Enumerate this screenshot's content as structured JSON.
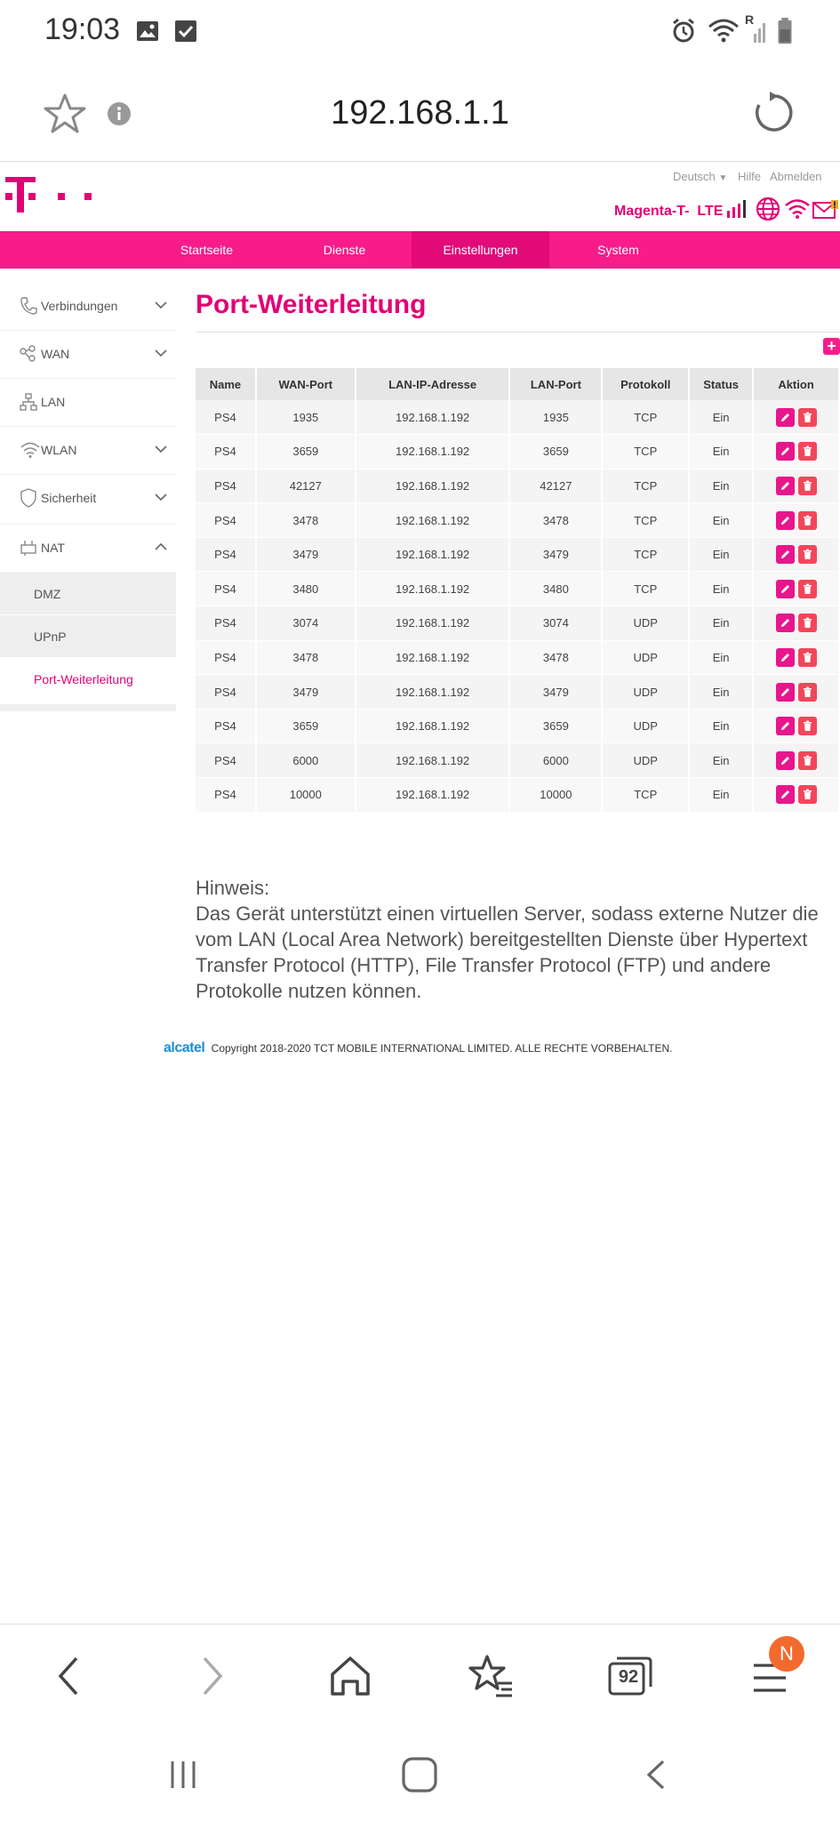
{
  "status_bar": {
    "time": "19:03",
    "icons": [
      "image-icon",
      "checkbox-icon",
      "alarm-icon",
      "wifi-icon",
      "signal-roaming-icon",
      "battery-icon"
    ],
    "roaming_label": "R"
  },
  "browser": {
    "url": "192.168.1.1",
    "icons": [
      "star-icon",
      "info-icon",
      "reload-icon"
    ]
  },
  "router": {
    "top_links": [
      "Deutsch",
      "Hilfe",
      "Abmelden"
    ],
    "operator": "Magenta-T-",
    "network_type": "LTE",
    "nav": [
      "Startseite",
      "Dienste",
      "Einstellungen",
      "System"
    ],
    "active_nav": "Einstellungen"
  },
  "sidebar": {
    "items": [
      {
        "label": "Verbindungen",
        "icon": "phone-icon",
        "expanded": false
      },
      {
        "label": "WAN",
        "icon": "wan-icon",
        "expanded": false
      },
      {
        "label": "LAN",
        "icon": "lan-icon",
        "expanded": null
      },
      {
        "label": "WLAN",
        "icon": "wifi-icon",
        "expanded": false
      },
      {
        "label": "Sicherheit",
        "icon": "shield-icon",
        "expanded": false
      },
      {
        "label": "NAT",
        "icon": "nat-icon",
        "expanded": true
      }
    ],
    "sub_items": [
      "DMZ",
      "UPnP",
      "Port-Weiterleitung"
    ],
    "active_sub": "Port-Weiterleitung"
  },
  "page": {
    "title": "Port-Weiterleitung",
    "add_label": "+"
  },
  "table": {
    "headers": [
      "Name",
      "WAN-Port",
      "LAN-IP-Adresse",
      "LAN-Port",
      "Protokoll",
      "Status",
      "Aktion"
    ],
    "rows": [
      [
        "PS4",
        "1935",
        "192.168.1.192",
        "1935",
        "TCP",
        "Ein"
      ],
      [
        "PS4",
        "3659",
        "192.168.1.192",
        "3659",
        "TCP",
        "Ein"
      ],
      [
        "PS4",
        "42127",
        "192.168.1.192",
        "42127",
        "TCP",
        "Ein"
      ],
      [
        "PS4",
        "3478",
        "192.168.1.192",
        "3478",
        "TCP",
        "Ein"
      ],
      [
        "PS4",
        "3479",
        "192.168.1.192",
        "3479",
        "TCP",
        "Ein"
      ],
      [
        "PS4",
        "3480",
        "192.168.1.192",
        "3480",
        "TCP",
        "Ein"
      ],
      [
        "PS4",
        "3074",
        "192.168.1.192",
        "3074",
        "UDP",
        "Ein"
      ],
      [
        "PS4",
        "3478",
        "192.168.1.192",
        "3478",
        "UDP",
        "Ein"
      ],
      [
        "PS4",
        "3479",
        "192.168.1.192",
        "3479",
        "UDP",
        "Ein"
      ],
      [
        "PS4",
        "3659",
        "192.168.1.192",
        "3659",
        "UDP",
        "Ein"
      ],
      [
        "PS4",
        "6000",
        "192.168.1.192",
        "6000",
        "UDP",
        "Ein"
      ],
      [
        "PS4",
        "10000",
        "192.168.1.192",
        "10000",
        "TCP",
        "Ein"
      ]
    ]
  },
  "hint": {
    "title": "Hinweis:",
    "text": "Das Gerät unterstützt einen virtuellen Server, sodass externe Nutzer die vom LAN (Local Area Network) bereitgestellten Dienste über Hypertext Transfer Protocol (HTTP), File Transfer Protocol (FTP) und andere Protokolle nutzen können."
  },
  "footer": {
    "brand": "alcatel",
    "copyright": "Copyright 2018-2020 TCT MOBILE INTERNATIONAL LIMITED. ALLE RECHTE VORBEHALTEN."
  },
  "bottom_bar": {
    "tab_count": "92",
    "badge": "N",
    "icons": [
      "back-icon",
      "forward-icon",
      "home-icon",
      "bookmarks-icon",
      "tabs-icon",
      "menu-icon"
    ]
  },
  "colors": {
    "brand": "#e20074",
    "nav_bg": "#f71c8a",
    "badge": "#f26a2e"
  }
}
